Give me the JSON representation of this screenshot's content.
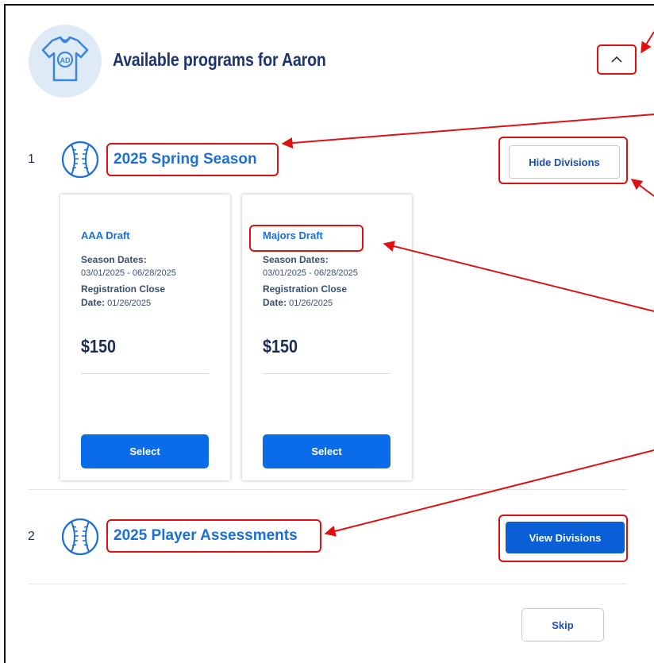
{
  "header": {
    "title": "Available programs for Aaron",
    "avatar_initials": "AD",
    "avatar_icon": "t-shirt-icon",
    "collapse_icon": "chevron-up-icon"
  },
  "programs": [
    {
      "number": "1",
      "name": "2025 Spring Season",
      "icon": "baseball-icon",
      "toggle_label": "Hide Divisions",
      "divisions": [
        {
          "title": "AAA Draft",
          "season_label": "Season Dates:",
          "season_dates": "03/01/2025 - 06/28/2025",
          "close_label_1": "Registration Close",
          "close_label_2": "Date:",
          "close_date": "01/26/2025",
          "price": "$150",
          "select_label": "Select"
        },
        {
          "title": "Majors Draft",
          "season_label": "Season Dates:",
          "season_dates": "03/01/2025 - 06/28/2025",
          "close_label_1": "Registration Close",
          "close_label_2": "Date:",
          "close_date": "01/26/2025",
          "price": "$150",
          "select_label": "Select"
        }
      ]
    },
    {
      "number": "2",
      "name": "2025 Player Assessments",
      "icon": "baseball-icon",
      "toggle_label": "View Divisions"
    }
  ],
  "footer": {
    "skip_label": "Skip"
  },
  "colors": {
    "brand_blue": "#0a6ce8",
    "title_navy": "#1d3473",
    "annotation_red": "#e01010"
  }
}
